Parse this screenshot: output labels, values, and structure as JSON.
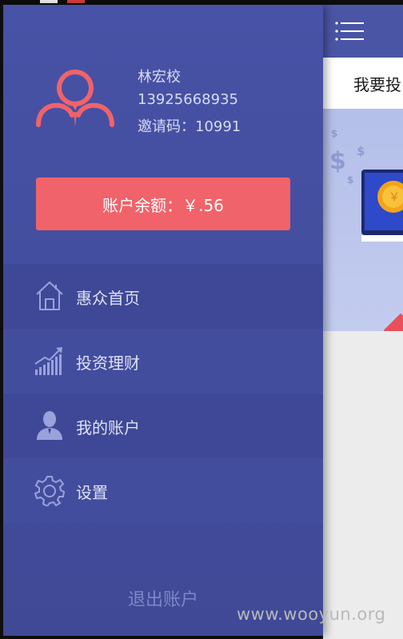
{
  "drawer": {
    "user": {
      "name": "林宏校",
      "phone": "13925668935",
      "invite": "邀请码：10991"
    },
    "balance_label": "账户余额：￥.56",
    "menu": [
      {
        "label": "惠众首页",
        "icon": "home-icon"
      },
      {
        "label": "投资理财",
        "icon": "bar-chart-icon"
      },
      {
        "label": "我的账户",
        "icon": "user-icon"
      },
      {
        "label": "设置",
        "icon": "gear-icon"
      }
    ],
    "logout_label": "退出账户"
  },
  "content": {
    "title": "我要投"
  },
  "watermark": "www.wooyun.org",
  "colors": {
    "drawer_bg": "#4852a6",
    "accent": "#f0636a",
    "text_light": "#dfe2f5"
  }
}
